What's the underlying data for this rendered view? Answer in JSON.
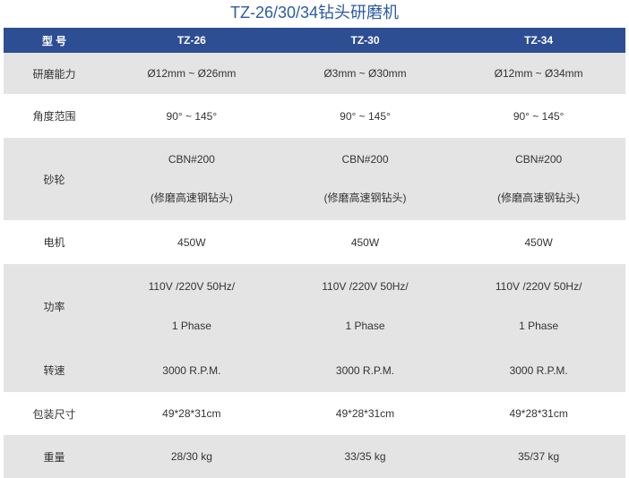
{
  "title": "TZ-26/30/34钻头研磨机",
  "header": {
    "label": "型  号",
    "models": [
      "TZ-26",
      "TZ-30",
      "TZ-34"
    ]
  },
  "rows": [
    {
      "label": "研磨能力",
      "values": [
        "Ø12mm ~ Ø26mm",
        "Ø3mm ~ Ø30mm",
        "Ø12mm ~ Ø34mm"
      ]
    },
    {
      "label": "角度范围",
      "values": [
        "90° ~ 145°",
        "90° ~ 145°",
        "90° ~ 145°"
      ]
    },
    {
      "label": "砂轮",
      "line1": [
        "CBN#200",
        "CBN#200",
        "CBN#200"
      ],
      "line2": [
        "(修磨高速钢钻头)",
        "(修磨高速钢钻头)",
        "(修磨高速钢钻头)"
      ]
    },
    {
      "label": "电机",
      "values": [
        "450W",
        "450W",
        "450W"
      ]
    },
    {
      "label": "功率",
      "line1": [
        "110V /220V 50Hz/",
        "110V /220V 50Hz/",
        "110V /220V 50Hz/"
      ],
      "line2": [
        "1 Phase",
        "1 Phase",
        "1 Phase"
      ]
    },
    {
      "label": "转速",
      "values": [
        "3000 R.P.M.",
        "3000 R.P.M.",
        "3000 R.P.M."
      ]
    },
    {
      "label": "包装尺寸",
      "values": [
        "49*28*31cm",
        "49*28*31cm",
        "49*28*31cm"
      ]
    },
    {
      "label": "重量",
      "values": [
        "28/30 kg",
        "33/35 kg",
        "35/37 kg"
      ]
    }
  ],
  "colors": {
    "header_bg": "#2e4e93",
    "title": "#2b5aa6",
    "stripe": "#e4e4e4"
  }
}
